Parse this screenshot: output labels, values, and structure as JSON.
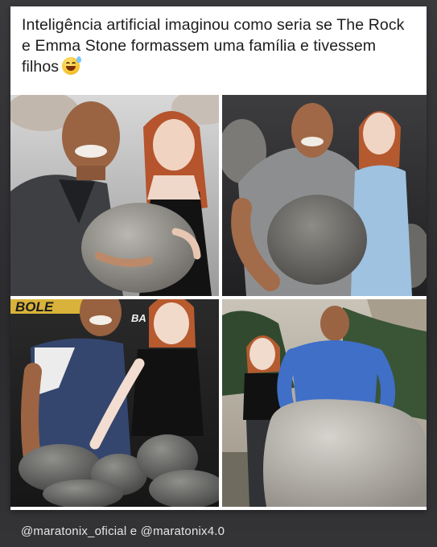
{
  "post": {
    "caption": "Inteligência artificial imaginou como seria se The Rock e Emma Stone formassem uma família e tivessem filhos",
    "caption_emoji": "grinning-sweat-emoji"
  },
  "images": {
    "p3_banner_left": "BOLE",
    "p3_banner_right": "BA   EMEA"
  },
  "footer": {
    "credit": "@maratonix_oficial e @maratonix4.0"
  }
}
